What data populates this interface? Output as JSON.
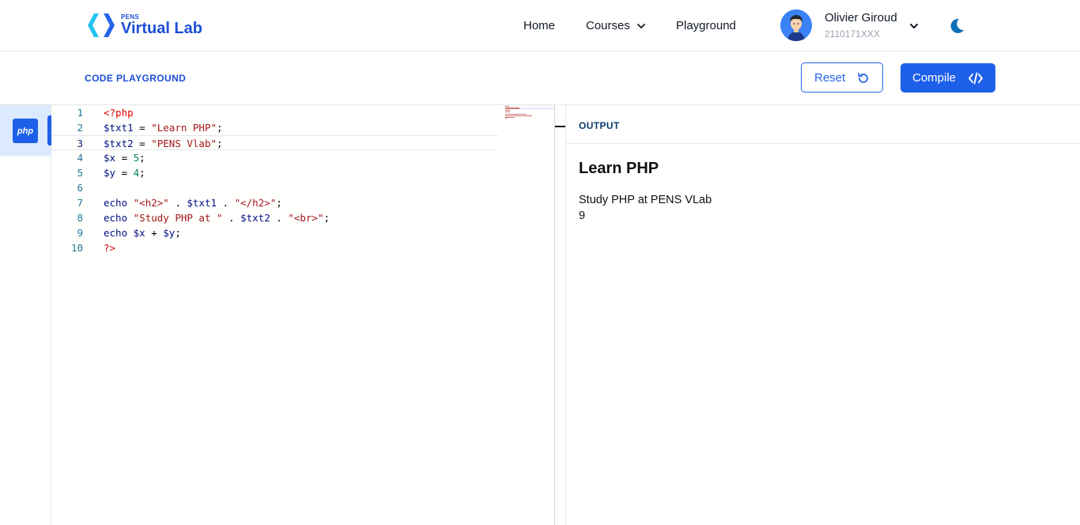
{
  "brand": {
    "small": "PENS",
    "name": "Virtual Lab"
  },
  "nav": {
    "home": "Home",
    "courses": "Courses",
    "playground": "Playground"
  },
  "user": {
    "name": "Olivier Giroud",
    "id": "2110171XXX"
  },
  "toolbar": {
    "title": "CODE PLAYGROUND",
    "reset_label": "Reset",
    "compile_label": "Compile"
  },
  "languages": [
    {
      "label": "php",
      "active": true
    }
  ],
  "editor": {
    "active_line": 3,
    "lines": [
      {
        "n": "1",
        "tokens": [
          {
            "t": "<?php",
            "c": "tag"
          }
        ]
      },
      {
        "n": "2",
        "tokens": [
          {
            "t": "$txt1",
            "c": "var"
          },
          {
            "t": " = ",
            "c": "plain"
          },
          {
            "t": "\"Learn PHP\"",
            "c": "str"
          },
          {
            "t": ";",
            "c": "plain"
          }
        ]
      },
      {
        "n": "3",
        "tokens": [
          {
            "t": "$txt2",
            "c": "var"
          },
          {
            "t": " = ",
            "c": "plain"
          },
          {
            "t": "\"PENS Vlab\"",
            "c": "str"
          },
          {
            "t": ";",
            "c": "plain"
          }
        ]
      },
      {
        "n": "4",
        "tokens": [
          {
            "t": "$x",
            "c": "var"
          },
          {
            "t": " = ",
            "c": "plain"
          },
          {
            "t": "5",
            "c": "num"
          },
          {
            "t": ";",
            "c": "plain"
          }
        ]
      },
      {
        "n": "5",
        "tokens": [
          {
            "t": "$y",
            "c": "var"
          },
          {
            "t": " = ",
            "c": "plain"
          },
          {
            "t": "4",
            "c": "num"
          },
          {
            "t": ";",
            "c": "plain"
          }
        ]
      },
      {
        "n": "6",
        "tokens": []
      },
      {
        "n": "7",
        "tokens": [
          {
            "t": "echo",
            "c": "var"
          },
          {
            "t": " ",
            "c": "plain"
          },
          {
            "t": "\"<h2>\"",
            "c": "str"
          },
          {
            "t": " . ",
            "c": "plain"
          },
          {
            "t": "$txt1",
            "c": "var"
          },
          {
            "t": " . ",
            "c": "plain"
          },
          {
            "t": "\"</h2>\"",
            "c": "str"
          },
          {
            "t": ";",
            "c": "plain"
          }
        ]
      },
      {
        "n": "8",
        "tokens": [
          {
            "t": "echo",
            "c": "var"
          },
          {
            "t": " ",
            "c": "plain"
          },
          {
            "t": "\"Study PHP at \"",
            "c": "str"
          },
          {
            "t": " . ",
            "c": "plain"
          },
          {
            "t": "$txt2",
            "c": "var"
          },
          {
            "t": " . ",
            "c": "plain"
          },
          {
            "t": "\"<br>\"",
            "c": "str"
          },
          {
            "t": ";",
            "c": "plain"
          }
        ]
      },
      {
        "n": "9",
        "tokens": [
          {
            "t": "echo",
            "c": "var"
          },
          {
            "t": " ",
            "c": "plain"
          },
          {
            "t": "$x",
            "c": "var"
          },
          {
            "t": " + ",
            "c": "plain"
          },
          {
            "t": "$y",
            "c": "var"
          },
          {
            "t": ";",
            "c": "plain"
          }
        ]
      },
      {
        "n": "10",
        "tokens": [
          {
            "t": "?>",
            "c": "tag"
          }
        ]
      }
    ]
  },
  "output": {
    "title": "OUTPUT",
    "heading": "Learn PHP",
    "line1": "Study PHP at PENS VLab",
    "line2": "9"
  },
  "colors": {
    "accent": "#1d5fe8",
    "tag": "#e00000",
    "string": "#a31515",
    "variable": "#001080",
    "number": "#098658"
  },
  "icons": {
    "courses_chevron": "chevron-down-icon",
    "user_chevron": "chevron-down-icon",
    "theme": "moon-icon",
    "reset": "rotate-ccw-icon",
    "compile": "code-icon"
  }
}
